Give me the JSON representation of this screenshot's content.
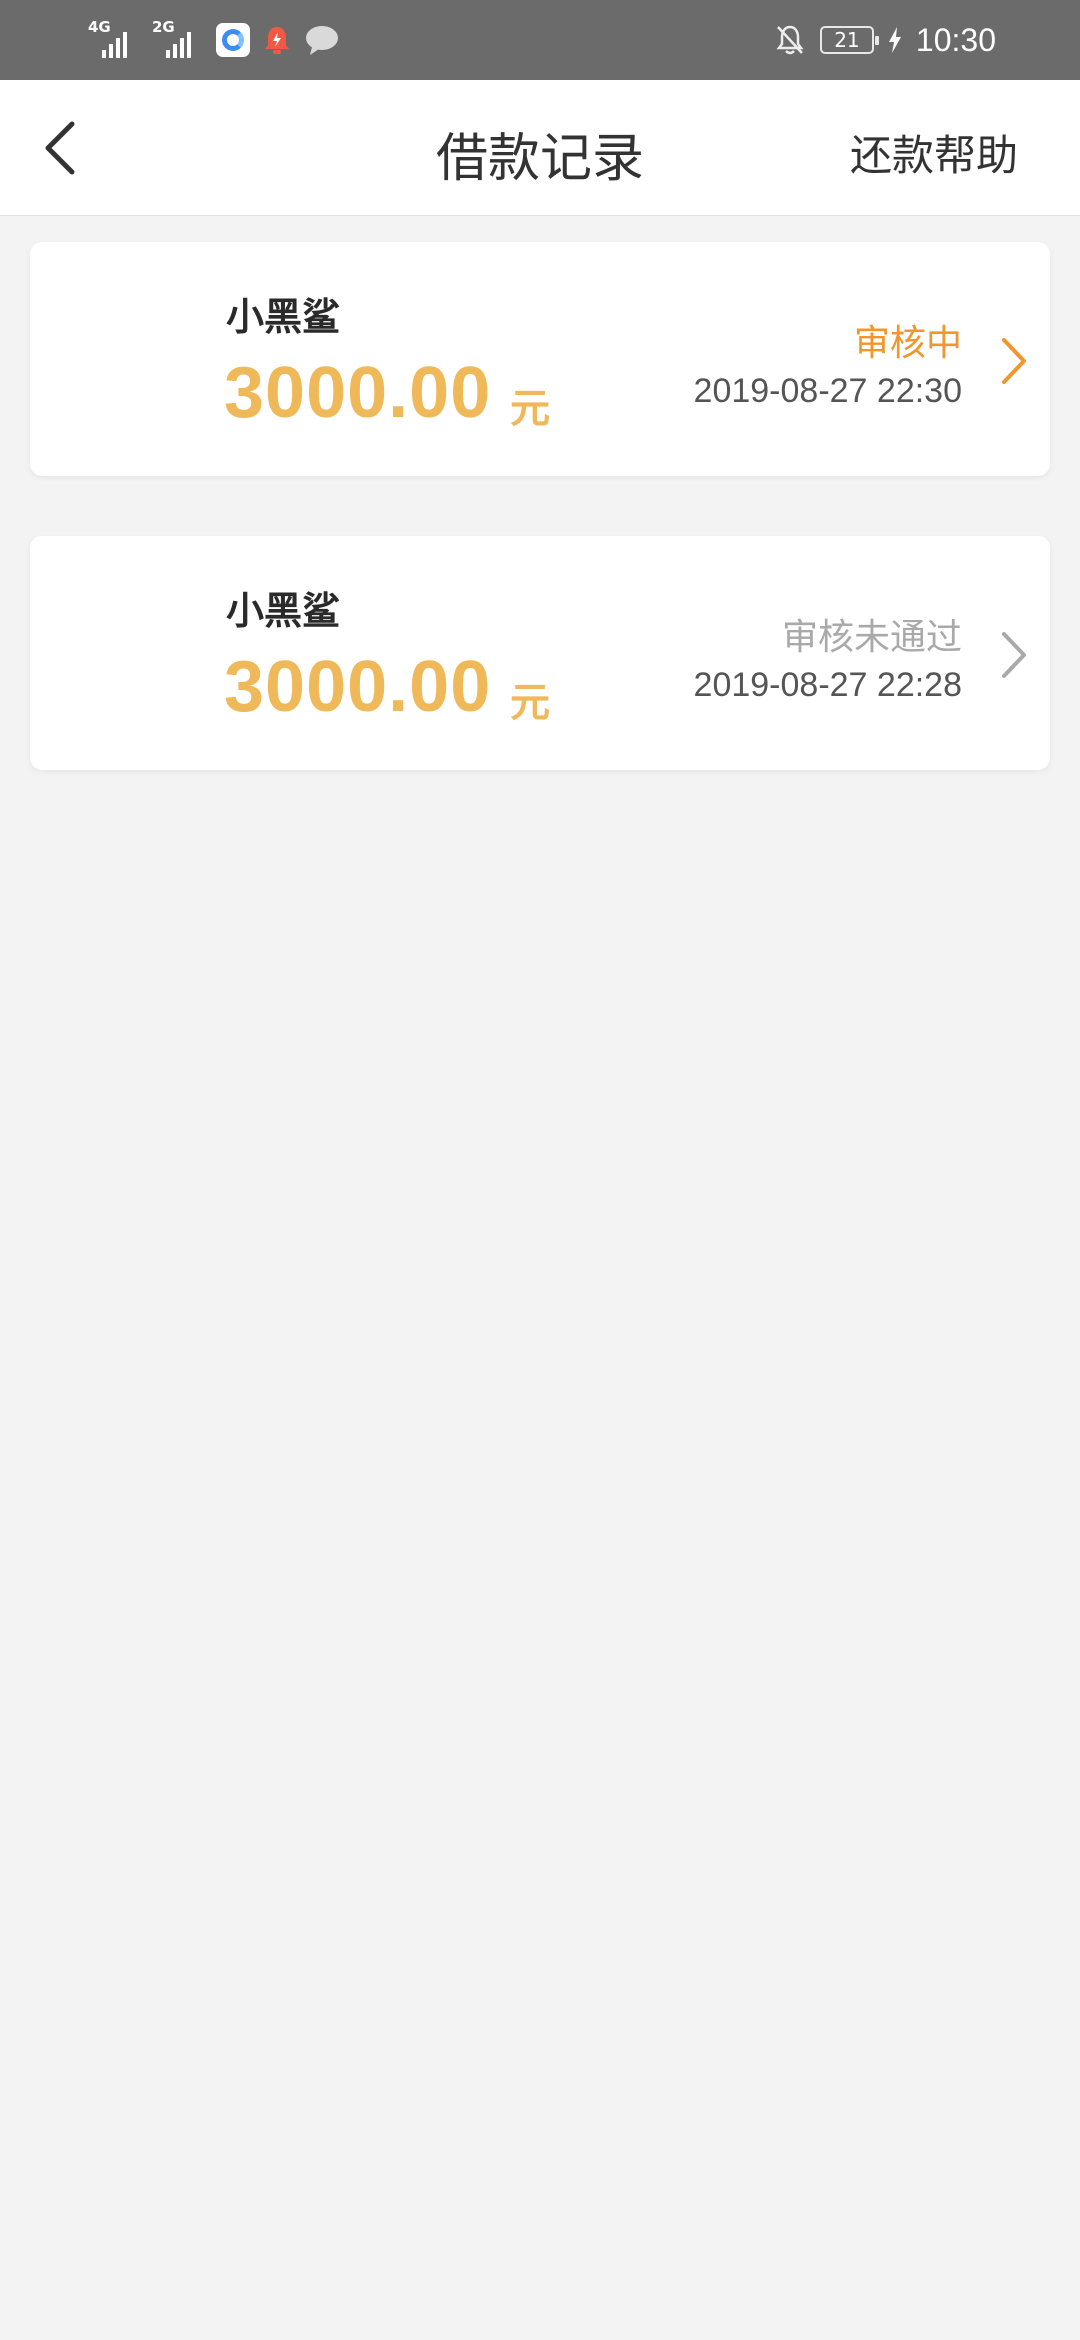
{
  "status_bar": {
    "net1": "4G",
    "net2": "2G",
    "battery": "21",
    "time": "10:30"
  },
  "nav": {
    "title": "借款记录",
    "help": "还款帮助"
  },
  "records": [
    {
      "name": "小黑鲨",
      "amount": "3000.00",
      "unit": "元",
      "status": "审核中",
      "status_color": "#f0962d",
      "date": "2019-08-27 22:30",
      "chevron_color": "#f0962d"
    },
    {
      "name": "小黑鲨",
      "amount": "3000.00",
      "unit": "元",
      "status": "审核未通过",
      "status_color": "#a9a9a9",
      "date": "2019-08-27 22:28",
      "chevron_color": "#a9a9a9"
    }
  ],
  "colors": {
    "amount": "#efb95a",
    "background": "#f3f3f3",
    "status_bar": "#6b6b6b"
  }
}
